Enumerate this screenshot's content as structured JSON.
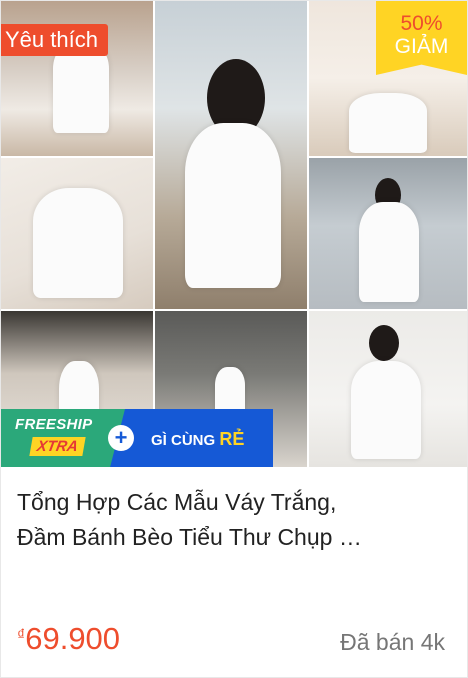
{
  "product": {
    "badge_label": "Yêu thích",
    "discount_percent": "50%",
    "discount_word": "GIẢM",
    "shipping_promo": {
      "freeship": "FREESHIP",
      "xtra": "XTRA",
      "plus": "+",
      "cheap_prefix": "GÌ CÙNG ",
      "cheap_suffix": "RẺ"
    },
    "title_line1": "Tổng Hợp Các Mẫu Váy Trắng,",
    "title_line2": "Đầm Bánh Bèo Tiểu Thư Chụp …",
    "currency": "₫",
    "price": "69.900",
    "sold": "Đã bán 4k"
  },
  "colors": {
    "accent": "#ee4d2d",
    "discount_badge": "#ffd424",
    "ship_blue": "#1559d6",
    "ship_green": "#2ba87a"
  }
}
